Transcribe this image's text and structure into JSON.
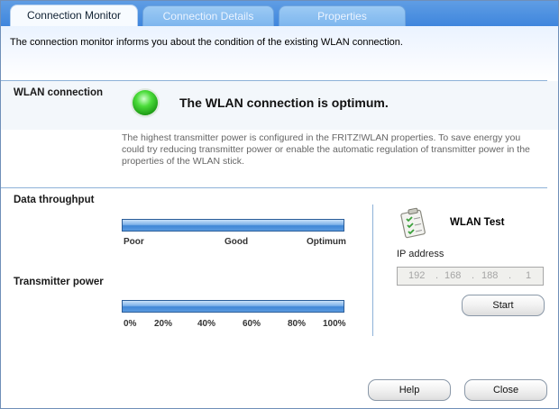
{
  "tabs": [
    {
      "label": "Connection Monitor",
      "active": true
    },
    {
      "label": "Connection Details",
      "active": false
    },
    {
      "label": "Properties",
      "active": false
    }
  ],
  "intro_text": "The connection monitor informs you about the condition of the existing WLAN connection.",
  "wlan_connection": {
    "title": "WLAN connection",
    "status_icon": "green-status-led-icon",
    "status_message": "The WLAN connection is optimum.",
    "info": "The highest transmitter power is configured in the FRITZ!WLAN properties. To save energy you could try reducing transmitter power or enable the automatic regulation of transmitter power in the properties of the WLAN stick."
  },
  "data_throughput": {
    "title": "Data throughput",
    "level_fraction": 1.0,
    "scale": [
      "Poor",
      "Good",
      "Optimum"
    ]
  },
  "transmitter_power": {
    "title": "Transmitter power",
    "level_percent": 100,
    "scale": [
      "0%",
      "20%",
      "40%",
      "60%",
      "80%",
      "100%"
    ]
  },
  "wlan_test": {
    "title": "WLAN Test",
    "icon": "clipboard-checklist-icon",
    "ip_label": "IP address",
    "ip_octets": [
      "192",
      "168",
      "188",
      "1"
    ],
    "start_label": "Start"
  },
  "footer": {
    "help_label": "Help",
    "close_label": "Close"
  },
  "colors": {
    "tab_bar": "#3f86dd",
    "accent_blue": "#3f86d6",
    "status_green": "#4bdc3a"
  }
}
